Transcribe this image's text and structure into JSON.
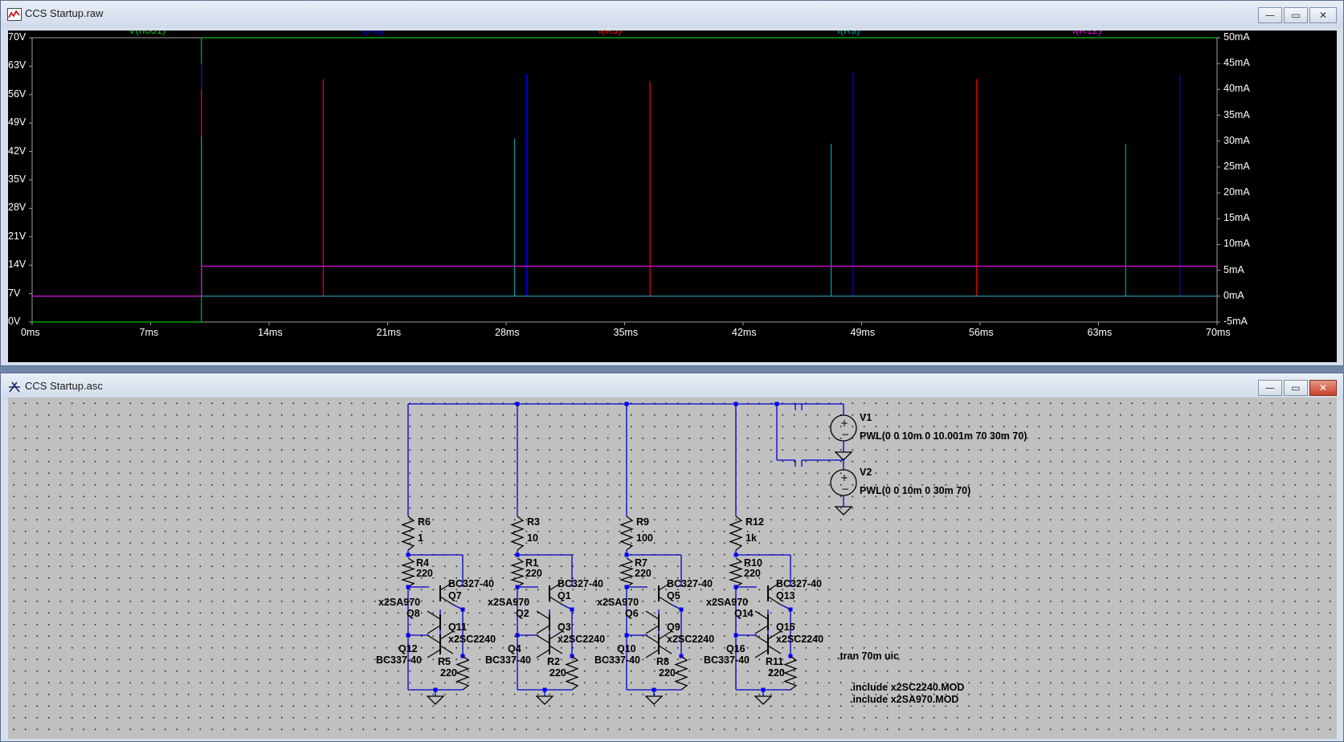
{
  "waveform_window": {
    "title": "CCS Startup.raw",
    "buttons": {
      "minimize": "—",
      "maximize": "▭",
      "close": "✕"
    },
    "chart_data": {
      "type": "line",
      "title": "",
      "xlabel": "",
      "ylabel_left": "",
      "ylabel_right": "",
      "x_ticks": [
        "0ms",
        "7ms",
        "14ms",
        "21ms",
        "28ms",
        "35ms",
        "42ms",
        "49ms",
        "56ms",
        "63ms",
        "70ms"
      ],
      "xlim_ms": [
        0,
        70
      ],
      "y_left_ticks": [
        "70V",
        "63V",
        "56V",
        "49V",
        "42V",
        "35V",
        "28V",
        "21V",
        "14V",
        "7V",
        "0V"
      ],
      "ylim_left_V": [
        0,
        70
      ],
      "y_right_ticks": [
        "50mA",
        "45mA",
        "40mA",
        "35mA",
        "30mA",
        "25mA",
        "20mA",
        "15mA",
        "10mA",
        "5mA",
        "0mA",
        "-5mA"
      ],
      "ylim_right_mA": [
        -5,
        50
      ],
      "grid": false,
      "legend_position": "top",
      "series": [
        {
          "name": "V(n001)",
          "color": "#00c000",
          "axis": "left",
          "points": [
            [
              0,
              0
            ],
            [
              10,
              0
            ],
            [
              10.001,
              70
            ],
            [
              70,
              70
            ]
          ]
        },
        {
          "name": "I(R6)",
          "color": "#0000ff",
          "axis": "right",
          "points": [
            [
              0,
              0
            ],
            [
              10,
              0
            ],
            [
              10,
              45
            ],
            [
              10,
              0
            ],
            [
              29.2,
              0
            ],
            [
              29.2,
              43
            ],
            [
              29.2,
              0
            ],
            [
              48.5,
              0
            ],
            [
              48.5,
              43.5
            ],
            [
              48.5,
              0
            ],
            [
              67.8,
              0
            ],
            [
              67.8,
              43
            ],
            [
              67.8,
              0
            ],
            [
              70,
              0
            ]
          ]
        },
        {
          "name": "I(R3)",
          "color": "#ff0000",
          "axis": "right",
          "points": [
            [
              0,
              0
            ],
            [
              10,
              0
            ],
            [
              10,
              40
            ],
            [
              10,
              0
            ],
            [
              17.2,
              0
            ],
            [
              17.2,
              42
            ],
            [
              17.2,
              0
            ],
            [
              36.5,
              0
            ],
            [
              36.5,
              41.5
            ],
            [
              36.5,
              0
            ],
            [
              55.8,
              0
            ],
            [
              55.8,
              42
            ],
            [
              55.8,
              0
            ],
            [
              70,
              0
            ]
          ]
        },
        {
          "name": "I(R9)",
          "color": "#00a0a0",
          "axis": "right",
          "points": [
            [
              0,
              0
            ],
            [
              10,
              0
            ],
            [
              10,
              31
            ],
            [
              10,
              0
            ],
            [
              28.5,
              0
            ],
            [
              28.5,
              30.5
            ],
            [
              28.5,
              0
            ],
            [
              47.2,
              0
            ],
            [
              47.2,
              29.5
            ],
            [
              47.2,
              0
            ],
            [
              64.6,
              0
            ],
            [
              64.6,
              29.5
            ],
            [
              64.6,
              0
            ],
            [
              70,
              0
            ]
          ]
        },
        {
          "name": "I(R12)",
          "color": "#e000e0",
          "axis": "right",
          "points": [
            [
              0,
              0
            ],
            [
              10,
              0
            ],
            [
              10,
              5.8
            ],
            [
              70,
              5.8
            ]
          ]
        }
      ]
    }
  },
  "schematic_window": {
    "title": "CCS Startup.asc",
    "buttons": {
      "minimize": "—",
      "maximize": "▭",
      "close": "✕"
    },
    "stages": [
      {
        "r_top_name": "R6",
        "r_top_value": "1",
        "r_bias_name": "R4",
        "r_bias_value": "220",
        "pnp_model": "BC327-40",
        "pnp_name": "Q7",
        "pnp2_model": "x2SA970",
        "pnp2_name": "Q8",
        "npn2_name": "Q11",
        "npn2_model": "x2SC2240",
        "npn_name": "Q12",
        "npn_model": "BC337-40",
        "r_bot_name": "R5",
        "r_bot_value": "220"
      },
      {
        "r_top_name": "R3",
        "r_top_value": "10",
        "r_bias_name": "R1",
        "r_bias_value": "220",
        "pnp_model": "BC327-40",
        "pnp_name": "Q1",
        "pnp2_model": "x2SA970",
        "pnp2_name": "Q2",
        "npn2_name": "Q3",
        "npn2_model": "x2SC2240",
        "npn_name": "Q4",
        "npn_model": "BC337-40",
        "r_bot_name": "R2",
        "r_bot_value": "220"
      },
      {
        "r_top_name": "R9",
        "r_top_value": "100",
        "r_bias_name": "R7",
        "r_bias_value": "220",
        "pnp_model": "BC327-40",
        "pnp_name": "Q5",
        "pnp2_model": "x2SA970",
        "pnp2_name": "Q6",
        "npn2_name": "Q9",
        "npn2_model": "x2SC2240",
        "npn_name": "Q10",
        "npn_model": "BC337-40",
        "r_bot_name": "R8",
        "r_bot_value": "220"
      },
      {
        "r_top_name": "R12",
        "r_top_value": "1k",
        "r_bias_name": "R10",
        "r_bias_value": "220",
        "pnp_model": "BC327-40",
        "pnp_name": "Q13",
        "pnp2_model": "x2SA970",
        "pnp2_name": "Q14",
        "npn2_name": "Q15",
        "npn2_model": "x2SC2240",
        "npn_name": "Q16",
        "npn_model": "BC337-40",
        "r_bot_name": "R11",
        "r_bot_value": "220"
      }
    ],
    "sources": [
      {
        "name": "V1",
        "value": "PWL(0 0 10m 0 10.001m 70 30m 70)"
      },
      {
        "name": "V2",
        "value": "PWL(0 0 10m 0 30m 70)"
      }
    ],
    "directives": {
      "tran": ".tran 70m uic",
      "include1": ".include x2SC2240.MOD",
      "include2": ".include x2SA970.MOD"
    },
    "colors": {
      "wire": "#0000c8",
      "component": "#000000",
      "junction": "#0000ff",
      "background": "#c0c0c0"
    }
  }
}
